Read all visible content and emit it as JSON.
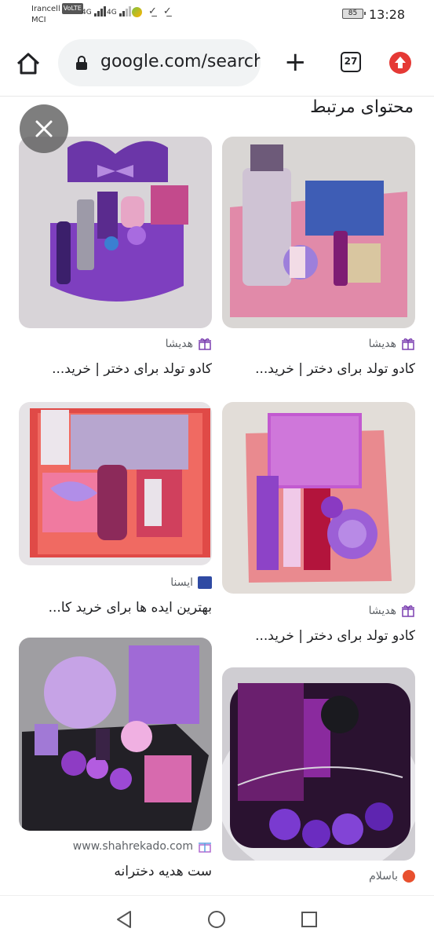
{
  "status_bar": {
    "carrier_1": "Irancell",
    "volte": "VoLTE",
    "carrier_2": "MCI",
    "net_1": "4G",
    "net_2": "4G",
    "battery": "85",
    "time": "13:28"
  },
  "browser": {
    "url": "google.com/search",
    "tab_count": "27",
    "icons": {
      "home": "home-icon",
      "lock": "lock-icon",
      "new_tab": "plus-icon",
      "update": "update-arrow-icon"
    }
  },
  "content": {
    "section_title": "محتوای مرتبط",
    "close_icon": "close-icon",
    "results": [
      {
        "source": "هدیشا",
        "title": "کادو تولد برای دختر | خرید...",
        "image_desc": "heart-shaped purple gift box"
      },
      {
        "source": "هدیشا",
        "title": "کادو تولد برای دختر | خرید...",
        "image_desc": "pink gift box with perfume"
      },
      {
        "source": "ایسنا",
        "title": "بهترین ایده ها برای خرید کا...",
        "image_desc": "red lavender gift box"
      },
      {
        "source": "هدیشا",
        "title": "کادو تولد برای دختر | خرید...",
        "image_desc": "purple notebook gift box"
      },
      {
        "source": "www.shahrekado.com",
        "title": "ست هدیه دخترانه",
        "image_desc": "purple bag gift set"
      },
      {
        "source": "باسلام",
        "title": "",
        "image_desc": "purple cosmetic gift basket"
      }
    ]
  },
  "colors": {
    "accent_red": "#e53935",
    "purple": "#7b3fb0",
    "pink": "#e88aa8"
  },
  "nav_bar": {
    "back": "back-triangle-icon",
    "home": "home-circle-icon",
    "recents": "recents-square-icon"
  }
}
